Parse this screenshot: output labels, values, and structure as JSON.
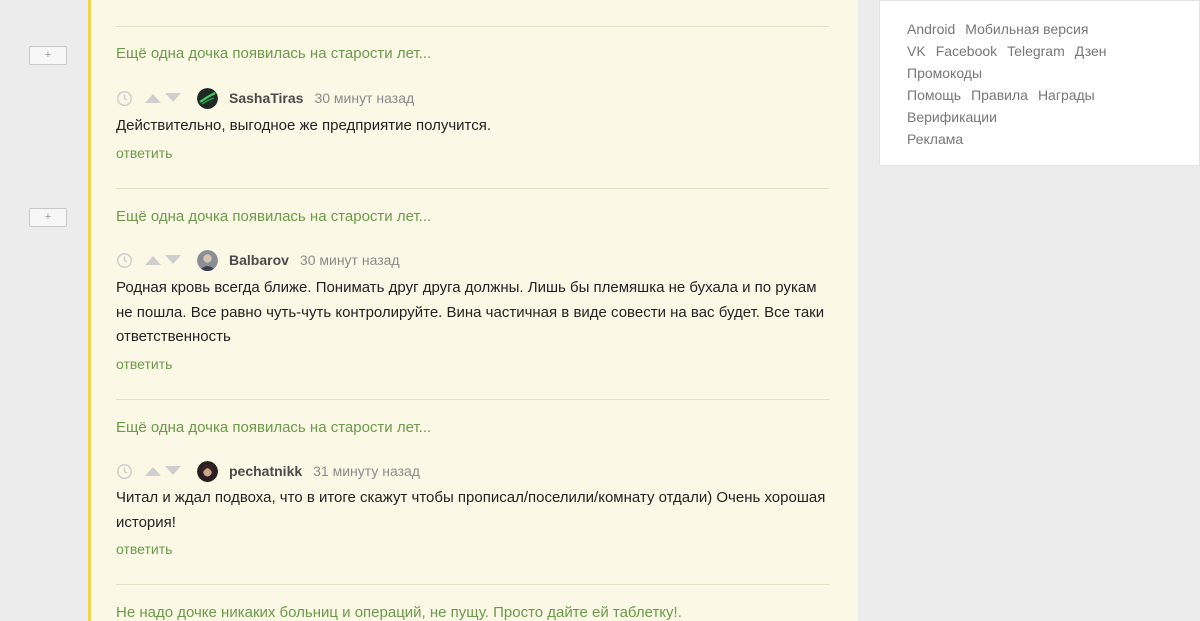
{
  "comments": [
    {
      "parent_title": "Ещё одна дочка появилась на старости лет...",
      "username": "SashaTiras",
      "time": "30 минут назад",
      "text": "Действительно, выгодное же предприятие получится.",
      "reply_label": "ответить"
    },
    {
      "parent_title": "Ещё одна дочка появилась на старости лет...",
      "username": "Balbarov",
      "time": "30 минут назад",
      "text": "Родная кровь всегда ближе. Понимать друг друга должны. Лишь бы племяшка не бухала и по рукам не пошла. Все равно чуть-чуть контролируйте. Вина частичная в виде совести на вас будет. Все таки ответственность",
      "reply_label": "ответить"
    },
    {
      "parent_title": "Ещё одна дочка появилась на старости лет...",
      "username": "pechatnikk",
      "time": "31 минуту назад",
      "text": "Читал и ждал подвоха, что в итоге скажут чтобы прописал/поселили/комнату отдали) Очень хорошая история!",
      "reply_label": "ответить"
    }
  ],
  "next_parent_title": "Не надо дочке никаких больниц и операций, не пущу. Просто дайте ей таблетку!.",
  "collapse_label": "+",
  "sidebar": {
    "row1": [
      "Android",
      "Мобильная версия"
    ],
    "row2": [
      "VK",
      "Facebook",
      "Telegram",
      "Дзен"
    ],
    "row3": [
      "Промокоды"
    ],
    "row4": [
      "Помощь",
      "Правила",
      "Награды"
    ],
    "row5": [
      "Верификации"
    ],
    "row6": [
      "Реклама"
    ]
  },
  "colors": {
    "accent_green": "#6a9a4a",
    "feed_background": "#fcf8e6",
    "thread_line": "#f0d447"
  }
}
